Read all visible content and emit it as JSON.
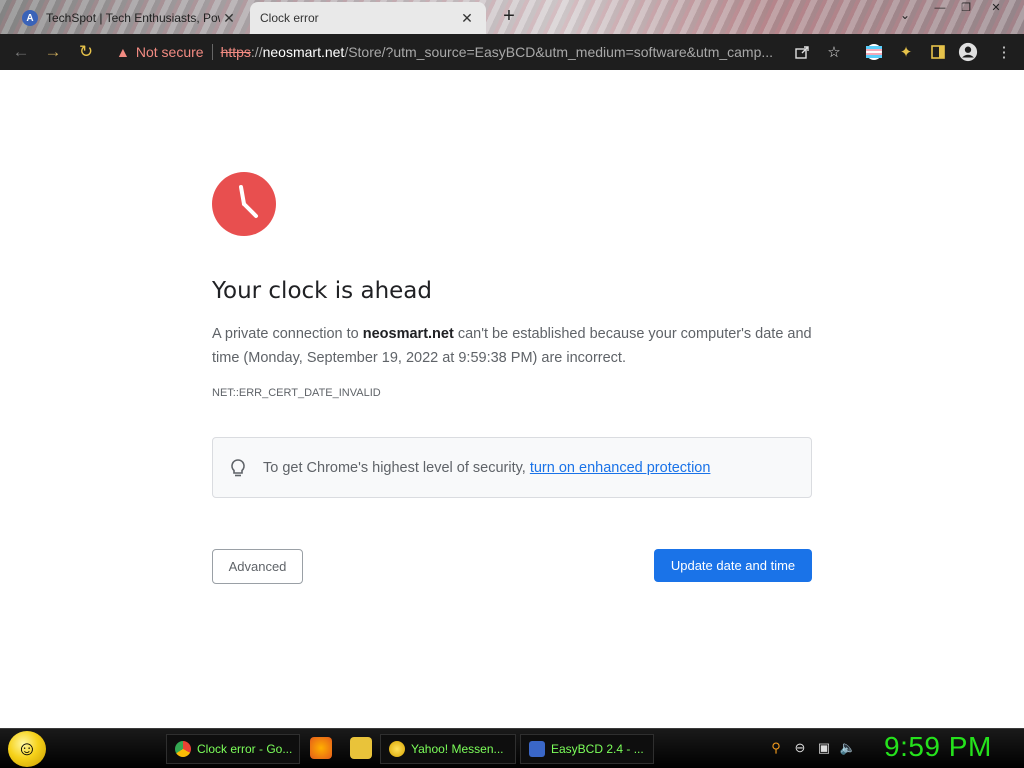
{
  "tabs": [
    {
      "title": "TechSpot | Tech Enthusiasts, Pow",
      "close": "✕"
    },
    {
      "title": "Clock error",
      "close": "✕"
    }
  ],
  "window": {
    "new_tab": "+",
    "minimize": "—",
    "maximize": "❐",
    "close": "✕",
    "tab_search": "⌄"
  },
  "toolbar": {
    "back_icon": "←",
    "forward_icon": "→",
    "reload_icon": "↻",
    "security_label": "Not secure",
    "url_scheme": "https",
    "url_scheme_sep": "://",
    "url_domain": "neosmart.net",
    "url_path": "/Store/?utm_source=EasyBCD&utm_medium=software&utm_camp..."
  },
  "page": {
    "headline": "Your clock is ahead",
    "para_before": "A private connection to ",
    "para_domain": "neosmart.net",
    "para_after": " can't be established because your computer's date and time (Monday, September 19, 2022 at 9:59:38 PM) are incorrect.",
    "error_code": "NET::ERR_CERT_DATE_INVALID",
    "tip_text": "To get Chrome's highest level of security, ",
    "tip_link": "turn on enhanced protection",
    "advanced_button": "Advanced",
    "update_button": "Update date and time"
  },
  "taskbar": {
    "items": [
      {
        "label": "Clock error - Go..."
      },
      {
        "label": "Yahoo! Messen..."
      },
      {
        "label": "EasyBCD 2.4 - ..."
      }
    ],
    "clock": "9:59 PM"
  },
  "colors": {
    "clock_icon": "#e84f4f",
    "primary_button": "#1a73e8",
    "link": "#1a73e8",
    "not_secure": "#f28b82",
    "taskbar_text": "#7CFF5A",
    "taskbar_clock": "#25e21c"
  }
}
